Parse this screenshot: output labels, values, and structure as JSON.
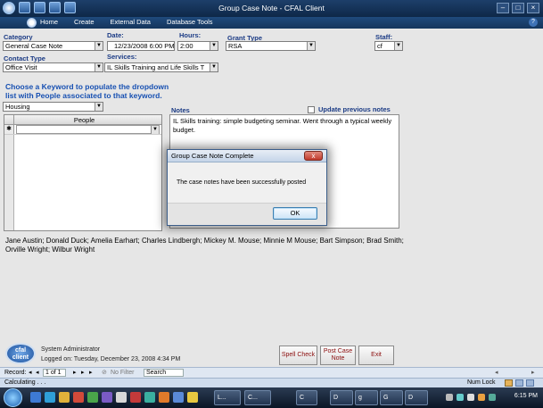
{
  "window": {
    "title": "Group Case Note - CFAL Client"
  },
  "ribbon": {
    "menu": [
      "Home",
      "Create",
      "External Data",
      "Database Tools"
    ]
  },
  "form": {
    "category": {
      "label": "Category",
      "value": "General Case Note"
    },
    "date": {
      "label": "Date:",
      "value": "12/23/2008 6:00 PM"
    },
    "hours": {
      "label": "Hours:",
      "value": "2:00"
    },
    "grant_type": {
      "label": "Grant Type",
      "value": "RSA"
    },
    "staff": {
      "label": "Staff:",
      "value": "cf"
    },
    "contact_type": {
      "label": "Contact Type",
      "value": "Office Visit"
    },
    "services": {
      "label": "Services:",
      "value": "IL Skills Training and Life Skills T"
    },
    "keyword_instruction": "Choose a Keyword to populate the dropdown list with People associated to that keyword.",
    "keyword": {
      "value": "Housing"
    },
    "people_grid": {
      "header": "People",
      "new_row_marker": "✱"
    },
    "notes": {
      "label": "Notes",
      "value": "IL Skills training: simple budgeting seminar. Went through a typical weekly budget.",
      "update_previous_label": "Update previous notes"
    },
    "people_list": "Jane Austin; Donald Duck; Amelia Earhart; Charles Lindbergh; Mickey M. Mouse; Minnie M Mouse; Bart Simpson; Brad Smith; Orville Wright; Wilbur Wright"
  },
  "dialog": {
    "title": "Group Case Note Complete",
    "message": "The case notes have been successfully posted",
    "ok_label": "OK",
    "close_glyph": "x"
  },
  "footer": {
    "logo_line1": "cfal",
    "logo_line2": "client",
    "user_name": "System Administrator",
    "logged_on": "Logged on: Tuesday, December 23, 2008 4:34 PM",
    "buttons": {
      "spell_check": "Spell Check",
      "post_case_note": "Post Case Note",
      "exit": "Exit"
    }
  },
  "navigator": {
    "record_label": "Record:",
    "position": "1 of 1",
    "filter_label": "No Filter",
    "search_label": "Search"
  },
  "status": {
    "left": "Calculating . . .",
    "num_lock": "Num Lock"
  },
  "taskbar": {
    "tasks": [
      "L...",
      "C...",
      "C",
      "D",
      "g",
      "G",
      "D"
    ],
    "clock": "6:15 PM"
  }
}
